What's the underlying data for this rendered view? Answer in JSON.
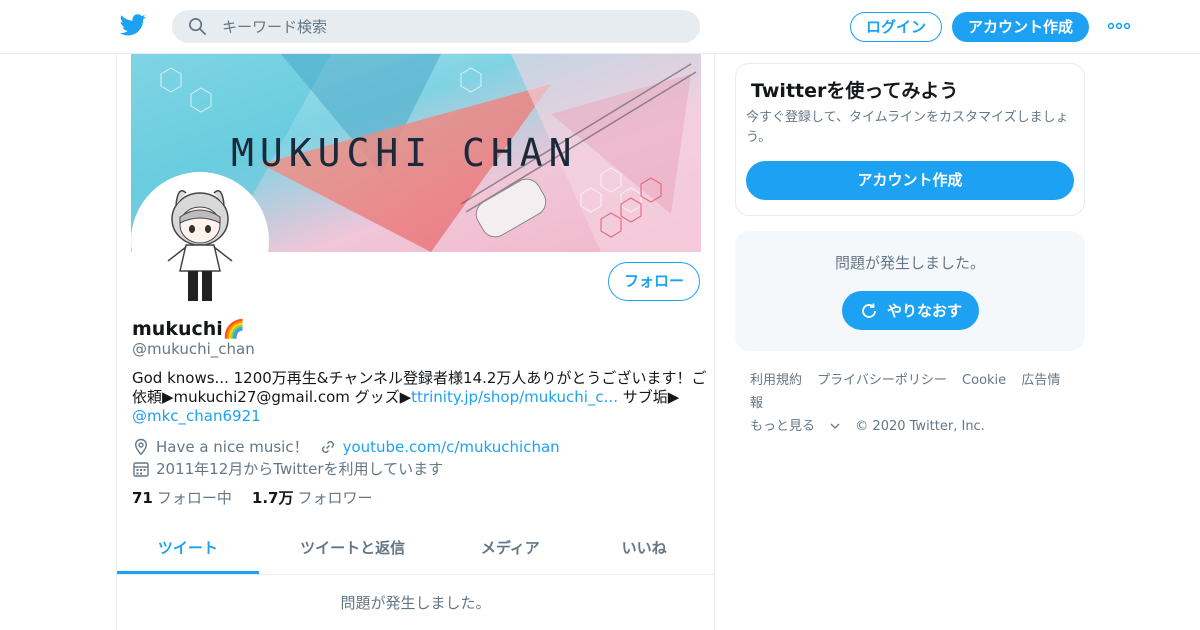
{
  "header": {
    "search_placeholder": "キーワード検索",
    "login_label": "ログイン",
    "signup_label": "アカウント作成"
  },
  "profile": {
    "banner_text": "MUKUCHI CHAN",
    "follow_label": "フォロー",
    "name": "mukuchi",
    "name_emoji": "🌈",
    "handle": "@mukuchi_chan",
    "bio_text_1": "God knows... 1200万再生&チャンネル登録者様14.2万人ありがとうございます！ご依頼▶mukuchi27@gmail.com グッズ▶",
    "bio_link_1": "ttrinity.jp/shop/mukuchi_c...",
    "bio_text_2": " サブ垢▶",
    "bio_link_2": "@mkc_chan6921",
    "location": "Have a nice music！",
    "website": "youtube.com/c/mukuchichan",
    "joined": "2011年12月からTwitterを利用しています",
    "following_count": "71",
    "following_label": "フォロー中",
    "followers_count": "1.7万",
    "followers_label": "フォロワー"
  },
  "tabs": [
    {
      "label": "ツイート",
      "active": true
    },
    {
      "label": "ツイートと返信",
      "active": false
    },
    {
      "label": "メディア",
      "active": false
    },
    {
      "label": "いいね",
      "active": false
    }
  ],
  "main_error": "問題が発生しました。",
  "sidebar": {
    "card_title": "Twitterを使ってみよう",
    "card_text": "今すぐ登録して、タイムラインをカスタマイズしましょう。",
    "card_button": "アカウント作成",
    "error_msg": "問題が発生しました。",
    "retry_label": "やりなおす"
  },
  "footer": {
    "links": [
      "利用規約",
      "プライバシーポリシー",
      "Cookie",
      "広告情報"
    ],
    "more": "もっと見る",
    "copyright": "© 2020 Twitter, Inc."
  },
  "colors": {
    "accent": "#1da1f2",
    "muted": "#657786",
    "border": "#e6ecf0"
  }
}
